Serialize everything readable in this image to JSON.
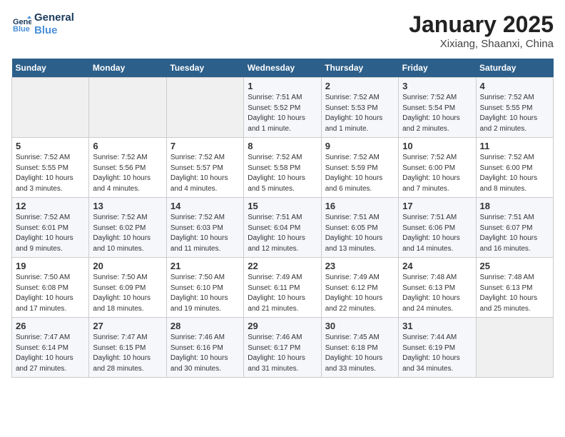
{
  "header": {
    "logo_line1": "General",
    "logo_line2": "Blue",
    "month": "January 2025",
    "location": "Xixiang, Shaanxi, China"
  },
  "weekdays": [
    "Sunday",
    "Monday",
    "Tuesday",
    "Wednesday",
    "Thursday",
    "Friday",
    "Saturday"
  ],
  "weeks": [
    [
      {
        "day": "",
        "info": ""
      },
      {
        "day": "",
        "info": ""
      },
      {
        "day": "",
        "info": ""
      },
      {
        "day": "1",
        "info": "Sunrise: 7:51 AM\nSunset: 5:52 PM\nDaylight: 10 hours\nand 1 minute."
      },
      {
        "day": "2",
        "info": "Sunrise: 7:52 AM\nSunset: 5:53 PM\nDaylight: 10 hours\nand 1 minute."
      },
      {
        "day": "3",
        "info": "Sunrise: 7:52 AM\nSunset: 5:54 PM\nDaylight: 10 hours\nand 2 minutes."
      },
      {
        "day": "4",
        "info": "Sunrise: 7:52 AM\nSunset: 5:55 PM\nDaylight: 10 hours\nand 2 minutes."
      }
    ],
    [
      {
        "day": "5",
        "info": "Sunrise: 7:52 AM\nSunset: 5:55 PM\nDaylight: 10 hours\nand 3 minutes."
      },
      {
        "day": "6",
        "info": "Sunrise: 7:52 AM\nSunset: 5:56 PM\nDaylight: 10 hours\nand 4 minutes."
      },
      {
        "day": "7",
        "info": "Sunrise: 7:52 AM\nSunset: 5:57 PM\nDaylight: 10 hours\nand 4 minutes."
      },
      {
        "day": "8",
        "info": "Sunrise: 7:52 AM\nSunset: 5:58 PM\nDaylight: 10 hours\nand 5 minutes."
      },
      {
        "day": "9",
        "info": "Sunrise: 7:52 AM\nSunset: 5:59 PM\nDaylight: 10 hours\nand 6 minutes."
      },
      {
        "day": "10",
        "info": "Sunrise: 7:52 AM\nSunset: 6:00 PM\nDaylight: 10 hours\nand 7 minutes."
      },
      {
        "day": "11",
        "info": "Sunrise: 7:52 AM\nSunset: 6:00 PM\nDaylight: 10 hours\nand 8 minutes."
      }
    ],
    [
      {
        "day": "12",
        "info": "Sunrise: 7:52 AM\nSunset: 6:01 PM\nDaylight: 10 hours\nand 9 minutes."
      },
      {
        "day": "13",
        "info": "Sunrise: 7:52 AM\nSunset: 6:02 PM\nDaylight: 10 hours\nand 10 minutes."
      },
      {
        "day": "14",
        "info": "Sunrise: 7:52 AM\nSunset: 6:03 PM\nDaylight: 10 hours\nand 11 minutes."
      },
      {
        "day": "15",
        "info": "Sunrise: 7:51 AM\nSunset: 6:04 PM\nDaylight: 10 hours\nand 12 minutes."
      },
      {
        "day": "16",
        "info": "Sunrise: 7:51 AM\nSunset: 6:05 PM\nDaylight: 10 hours\nand 13 minutes."
      },
      {
        "day": "17",
        "info": "Sunrise: 7:51 AM\nSunset: 6:06 PM\nDaylight: 10 hours\nand 14 minutes."
      },
      {
        "day": "18",
        "info": "Sunrise: 7:51 AM\nSunset: 6:07 PM\nDaylight: 10 hours\nand 16 minutes."
      }
    ],
    [
      {
        "day": "19",
        "info": "Sunrise: 7:50 AM\nSunset: 6:08 PM\nDaylight: 10 hours\nand 17 minutes."
      },
      {
        "day": "20",
        "info": "Sunrise: 7:50 AM\nSunset: 6:09 PM\nDaylight: 10 hours\nand 18 minutes."
      },
      {
        "day": "21",
        "info": "Sunrise: 7:50 AM\nSunset: 6:10 PM\nDaylight: 10 hours\nand 19 minutes."
      },
      {
        "day": "22",
        "info": "Sunrise: 7:49 AM\nSunset: 6:11 PM\nDaylight: 10 hours\nand 21 minutes."
      },
      {
        "day": "23",
        "info": "Sunrise: 7:49 AM\nSunset: 6:12 PM\nDaylight: 10 hours\nand 22 minutes."
      },
      {
        "day": "24",
        "info": "Sunrise: 7:48 AM\nSunset: 6:13 PM\nDaylight: 10 hours\nand 24 minutes."
      },
      {
        "day": "25",
        "info": "Sunrise: 7:48 AM\nSunset: 6:13 PM\nDaylight: 10 hours\nand 25 minutes."
      }
    ],
    [
      {
        "day": "26",
        "info": "Sunrise: 7:47 AM\nSunset: 6:14 PM\nDaylight: 10 hours\nand 27 minutes."
      },
      {
        "day": "27",
        "info": "Sunrise: 7:47 AM\nSunset: 6:15 PM\nDaylight: 10 hours\nand 28 minutes."
      },
      {
        "day": "28",
        "info": "Sunrise: 7:46 AM\nSunset: 6:16 PM\nDaylight: 10 hours\nand 30 minutes."
      },
      {
        "day": "29",
        "info": "Sunrise: 7:46 AM\nSunset: 6:17 PM\nDaylight: 10 hours\nand 31 minutes."
      },
      {
        "day": "30",
        "info": "Sunrise: 7:45 AM\nSunset: 6:18 PM\nDaylight: 10 hours\nand 33 minutes."
      },
      {
        "day": "31",
        "info": "Sunrise: 7:44 AM\nSunset: 6:19 PM\nDaylight: 10 hours\nand 34 minutes."
      },
      {
        "day": "",
        "info": ""
      }
    ]
  ]
}
